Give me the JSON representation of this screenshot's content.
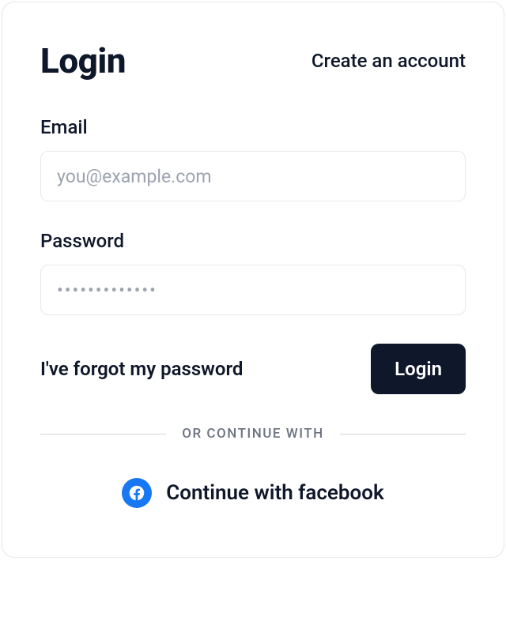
{
  "header": {
    "title": "Login",
    "create_account": "Create an account"
  },
  "fields": {
    "email": {
      "label": "Email",
      "placeholder": "you@example.com",
      "value": ""
    },
    "password": {
      "label": "Password",
      "placeholder": "•••••••••••••",
      "value": ""
    }
  },
  "actions": {
    "forgot": "I've forgot my password",
    "login": "Login"
  },
  "divider": "OR CONTINUE WITH",
  "social": {
    "facebook_label": "Continue with facebook"
  },
  "colors": {
    "facebook": "#1877F2",
    "text": "#0f172a",
    "border": "#e5e7eb",
    "muted": "#6b7280"
  }
}
